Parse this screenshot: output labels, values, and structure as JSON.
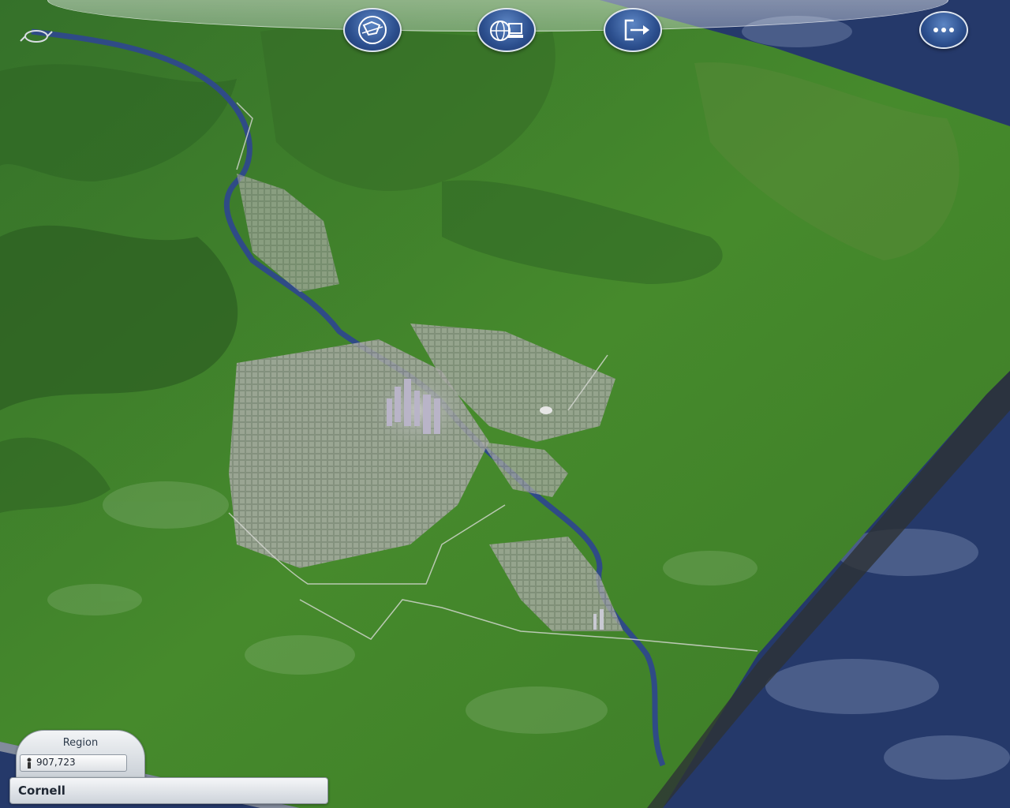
{
  "toolbar": {
    "buttons": [
      {
        "icon": "region-view-icon"
      },
      {
        "icon": "online-globe-computer-icon"
      },
      {
        "icon": "exit-icon"
      },
      {
        "icon": "more-options-icon"
      }
    ]
  },
  "region": {
    "title": "Region",
    "population": "907,723",
    "name": "Cornell"
  },
  "colors": {
    "terrain": "#3f7a26",
    "water": "#2f4b86",
    "button": "#2c4f8e"
  }
}
